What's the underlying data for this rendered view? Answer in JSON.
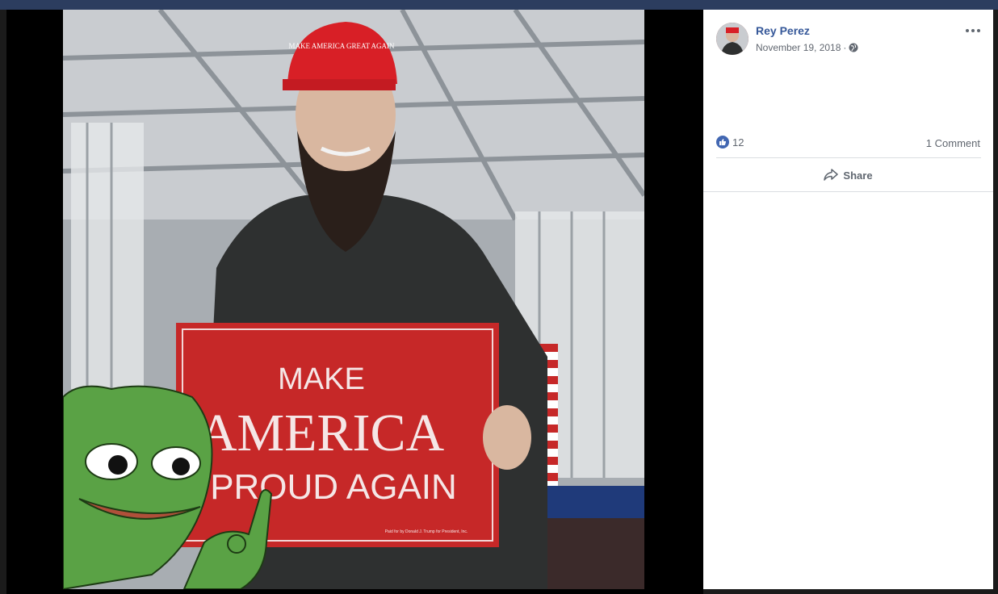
{
  "post": {
    "author": "Rey Perez",
    "date": "November 19, 2018",
    "separator": "·",
    "privacy_icon": "globe-icon",
    "like_count": "12",
    "comments_label": "1 Comment",
    "share_label": "Share"
  },
  "photo": {
    "hat_text": "MAKE AMERICA GREAT AGAIN",
    "sign_line1": "MAKE",
    "sign_line2": "AMERICA",
    "sign_line3": "PROUD AGAIN",
    "sign_fine_print": "Paid for by Donald J. Trump for President, Inc."
  },
  "colors": {
    "link": "#365899",
    "meta": "#616770",
    "like_blue": "#4267b2",
    "sign_red": "#c62828",
    "frog_green": "#5aa245"
  }
}
